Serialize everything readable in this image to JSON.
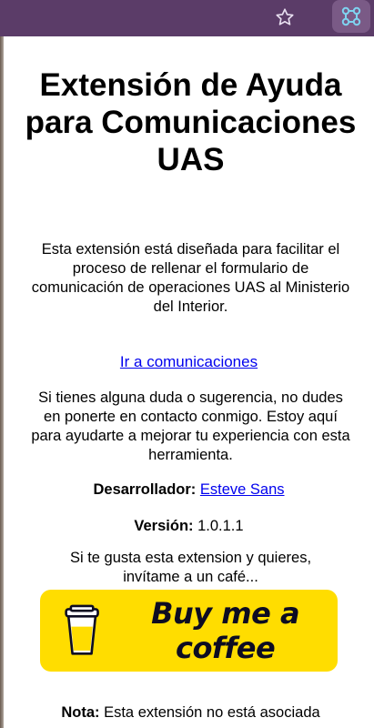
{
  "browser": {
    "star_icon": "star-outline",
    "extension_icon": "extension-puzzle"
  },
  "popup": {
    "title": "Extensión de Ayuda para Comunicaciones UAS",
    "description": "Esta extensión está diseñada para facilitar el proceso de rellenar el formulario de comunicación de operaciones UAS al Ministerio del Interior.",
    "comm_link": "Ir a comunicaciones",
    "help_text": "Si tienes alguna duda o sugerencia, no dudes en ponerte en contacto conmigo. Estoy aquí para ayudarte a mejorar tu experiencia con esta herramienta.",
    "developer_label": "Desarrollador:",
    "developer_name": "Esteve Sans",
    "version_label": "Versión:",
    "version_value": "1.0.1.1",
    "coffee_text": "Si te gusta esta extension y quieres, invítame a un café...",
    "bmc_label": "Buy me a coffee",
    "note_label": "Nota:",
    "note_text": "Esta extensión no está asociada"
  },
  "colors": {
    "browser_bar": "#5b3c68",
    "link": "#0000ee",
    "bmc_yellow": "#ffdd00",
    "bmc_text": "#0d0c22"
  }
}
